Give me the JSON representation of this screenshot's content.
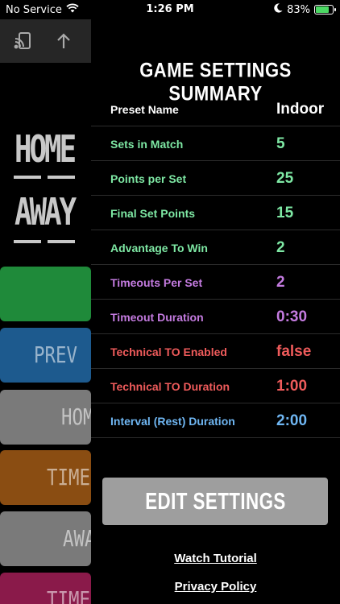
{
  "status_bar": {
    "carrier": "No Service",
    "time": "1:26 PM",
    "battery_percent": "83%",
    "battery_level": 0.83,
    "icons": [
      "wifi-icon",
      "moon-icon",
      "battery-charging-icon"
    ]
  },
  "background_app": {
    "toolbar_icons": [
      "cast-icon",
      "upload-arrow-icon"
    ],
    "home_label": "HOME",
    "away_label": "AWAY",
    "buttons": [
      {
        "label": "",
        "color": "#1f8a3a"
      },
      {
        "label": "PREV",
        "color": "#1d5a8e"
      },
      {
        "label": "HOM",
        "color": "#7a7a7a"
      },
      {
        "label": "TIMEO",
        "color": "#8a4d12"
      },
      {
        "label": "AWA",
        "color": "#7a7a7a"
      },
      {
        "label": "TIMEO",
        "color": "#8a1a4a"
      }
    ]
  },
  "summary": {
    "title": "GAME SETTINGS SUMMARY",
    "rows": [
      {
        "label": "Preset Name",
        "value": "Indoor",
        "color": "#ffffff"
      },
      {
        "label": "Sets in Match",
        "value": "5",
        "color": "#7ee8a4"
      },
      {
        "label": "Points per Set",
        "value": "25",
        "color": "#7ee8a4"
      },
      {
        "label": "Final Set Points",
        "value": "15",
        "color": "#7ee8a4"
      },
      {
        "label": "Advantage To Win",
        "value": "2",
        "color": "#7ee8a4"
      },
      {
        "label": "Timeouts Per Set",
        "value": "2",
        "color": "#c47be0"
      },
      {
        "label": "Timeout Duration",
        "value": "0:30",
        "color": "#c47be0"
      },
      {
        "label": "Technical TO Enabled",
        "value": "false",
        "color": "#ef5b5b"
      },
      {
        "label": "Technical TO Duration",
        "value": "1:00",
        "color": "#ef5b5b"
      },
      {
        "label": "Interval (Rest) Duration",
        "value": "2:00",
        "color": "#6fb6f2"
      }
    ],
    "edit_button_label": "EDIT SETTINGS",
    "watch_tutorial_label": "Watch Tutorial",
    "privacy_policy_label": "Privacy Policy"
  }
}
